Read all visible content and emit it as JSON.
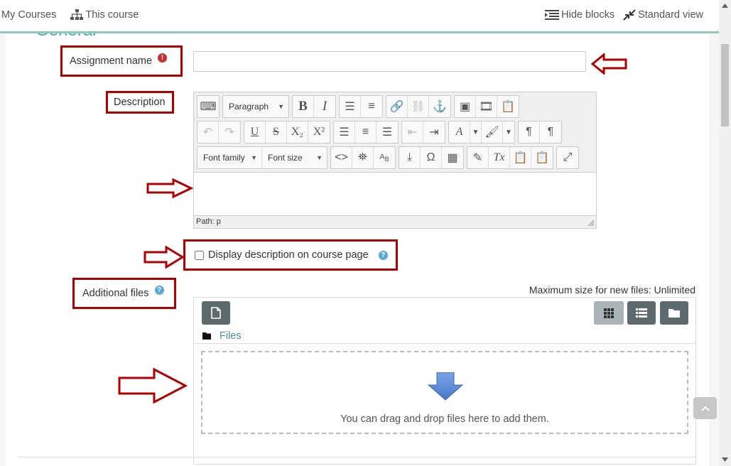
{
  "nav": {
    "my_courses": "My Courses",
    "this_course": "This course",
    "hide_blocks": "Hide blocks",
    "standard_view": "Standard view"
  },
  "section": {
    "title": "General"
  },
  "form": {
    "assignment_name_label": "Assignment name",
    "assignment_name_value": "",
    "description_label": "Description",
    "paragraph_select": "Paragraph",
    "font_family_select": "Font family",
    "font_size_select": "Font size",
    "path_label": "Path: p",
    "display_description_label": "Display description on course page",
    "additional_files_label": "Additional files",
    "max_size_text": "Maximum size for new files: Unlimited",
    "files_folder": "Files",
    "drop_text": "You can drag and drop files here to add them."
  },
  "icons": {
    "required": "exclamation-icon",
    "help": "question-icon",
    "arrow": "outline-arrow-icon"
  },
  "colors": {
    "accent": "#4aa99a",
    "highlight_box": "#b00000",
    "help": "#5aa7d8",
    "required": "#c9302c"
  }
}
